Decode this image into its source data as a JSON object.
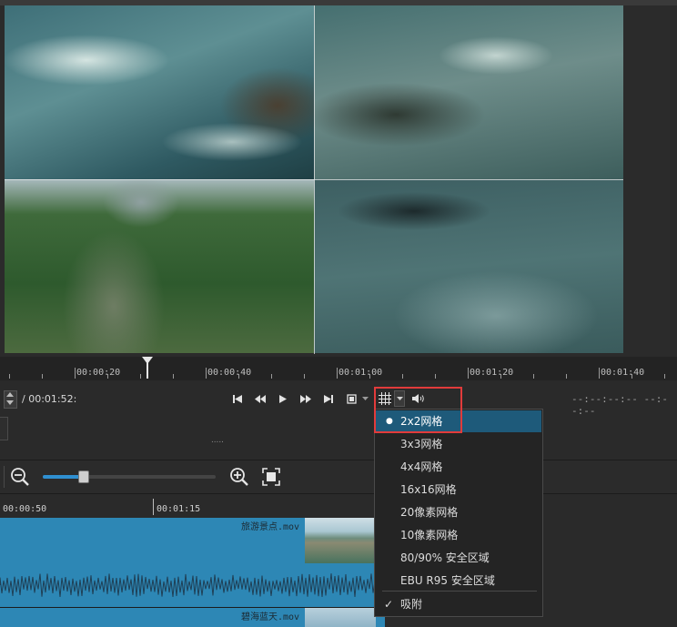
{
  "preview": {
    "quadrants": [
      "rapids-close",
      "rapids-foam",
      "river-bamboo-raft",
      "rapids-water"
    ]
  },
  "ruler": {
    "labels": [
      "00:00:20",
      "00:00:40",
      "00:01:00",
      "00:01:20",
      "00:01:40"
    ]
  },
  "transport": {
    "duration": "/ 00:01:52:",
    "timecode": "--:--:--:--  --:--:--",
    "buttons": {
      "skip_start": "⏮",
      "rewind": "⏪",
      "play": "▶",
      "fast_forward": "⏩",
      "skip_end": "⏭",
      "zoom": "⛶",
      "grid": "grid",
      "volume": "🔊"
    }
  },
  "middle": {
    "drag_handle": "....."
  },
  "timeline": {
    "labels": [
      "00:00:50",
      "00:01:15"
    ],
    "clips": [
      {
        "name": "旅游景点.mov"
      },
      {
        "name": "碧海蓝天.mov"
      }
    ]
  },
  "grid_menu": {
    "items": [
      {
        "label": "2x2网格",
        "selected": true
      },
      {
        "label": "3x3网格",
        "selected": false
      },
      {
        "label": "4x4网格",
        "selected": false
      },
      {
        "label": "16x16网格",
        "selected": false
      },
      {
        "label": "20像素网格",
        "selected": false
      },
      {
        "label": "10像素网格",
        "selected": false
      },
      {
        "label": "80/90% 安全区域",
        "selected": false
      },
      {
        "label": "EBU R95 安全区域",
        "selected": false
      }
    ],
    "snap": {
      "label": "吸附",
      "checked": true
    }
  },
  "colors": {
    "accent": "#2f8fd0",
    "track": "#2d87b5",
    "highlight": "#e23b3b",
    "menu_selected": "#1e5a7a"
  }
}
